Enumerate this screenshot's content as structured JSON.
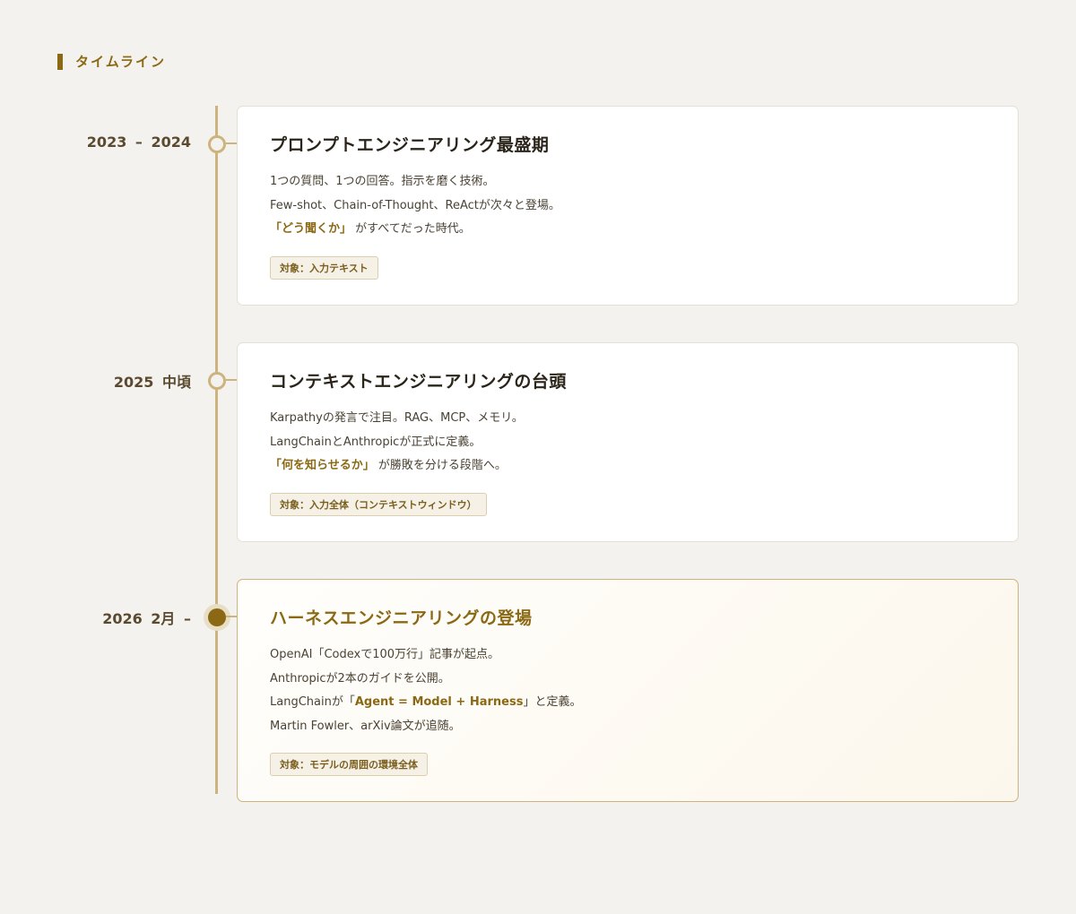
{
  "section": {
    "title": "タイムライン"
  },
  "entries": [
    {
      "date": "2023 – 2024",
      "title": "プロンプトエンジニアリング最盛期",
      "lines": [
        "1つの質問、1つの回答。指示を磨く技術。",
        "Few-shot、Chain-of-Thought、ReActが次々と登場。"
      ],
      "highlight_line": {
        "bold": "「どう聞くか」",
        "rest": " がすべてだった時代。"
      },
      "tag": "対象：入力テキスト"
    },
    {
      "date": "2025 中頃",
      "title": "コンテキストエンジニアリングの台頭",
      "lines": [
        "Karpathyの発言で注目。RAG、MCP、メモリ。",
        "LangChainとAnthropicが正式に定義。"
      ],
      "highlight_line": {
        "bold": "「何を知らせるか」",
        "rest": " が勝敗を分ける段階へ。"
      },
      "tag": "対象：入力全体（コンテキストウィンドウ）"
    },
    {
      "date": "2026 2月 –",
      "title": "ハーネスエンジニアリングの登場",
      "lines": [
        "OpenAI「Codexで100万行」記事が起点。",
        "Anthropicが2本のガイドを公開。"
      ],
      "mixed_line": {
        "before": "LangChainが「",
        "bold": "Agent = Model + Harness",
        "after": "」と定義。"
      },
      "last_line": "Martin Fowler、arXiv論文が追随。",
      "tag": "対象：モデルの周囲の環境全体"
    }
  ],
  "colors": {
    "accent": "#8b6914",
    "line": "#cdb47e",
    "background": "#f4f2ee"
  }
}
